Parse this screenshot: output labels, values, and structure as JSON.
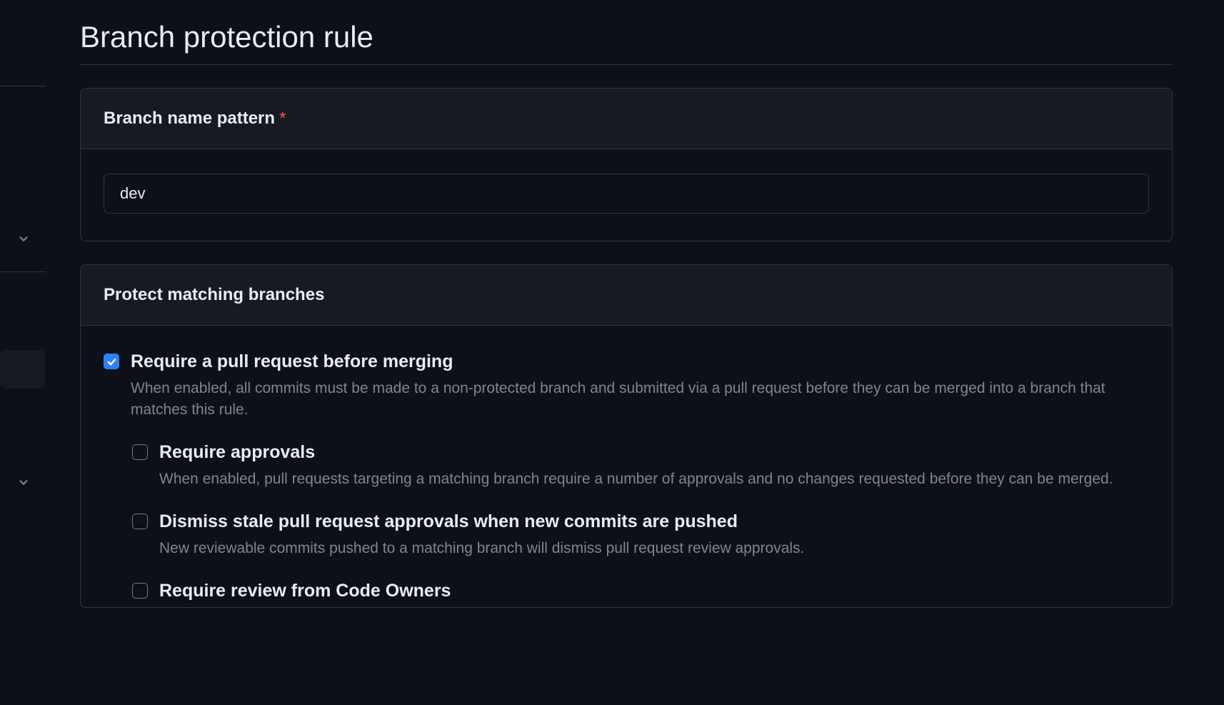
{
  "page": {
    "title": "Branch protection rule"
  },
  "pattern_card": {
    "header": "Branch name pattern",
    "required_mark": "*",
    "value": "dev"
  },
  "protect_card": {
    "header": "Protect matching branches",
    "options": [
      {
        "label": "Require a pull request before merging",
        "desc": "When enabled, all commits must be made to a non-protected branch and submitted via a pull request before they can be merged into a branch that matches this rule.",
        "checked": true,
        "nested": false
      },
      {
        "label": "Require approvals",
        "desc": "When enabled, pull requests targeting a matching branch require a number of approvals and no changes requested before they can be merged.",
        "checked": false,
        "nested": true
      },
      {
        "label": "Dismiss stale pull request approvals when new commits are pushed",
        "desc": "New reviewable commits pushed to a matching branch will dismiss pull request review approvals.",
        "checked": false,
        "nested": true
      },
      {
        "label": "Require review from Code Owners",
        "desc": "",
        "checked": false,
        "nested": true
      }
    ]
  }
}
